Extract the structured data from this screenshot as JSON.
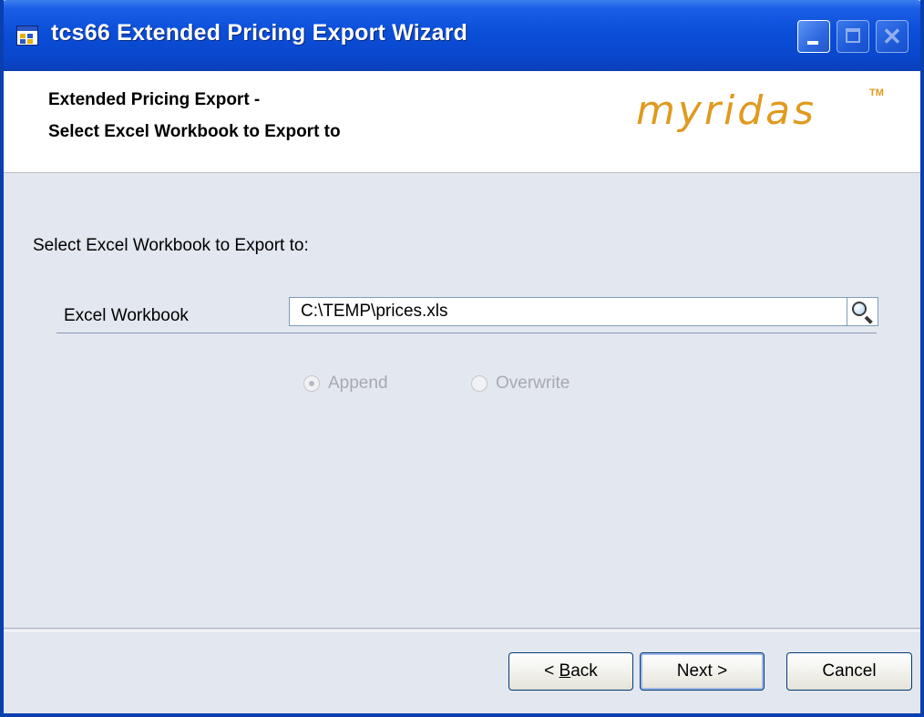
{
  "window": {
    "title": "tcs66 Extended Pricing Export Wizard",
    "controls": {
      "minimize_icon": "minimize-icon",
      "maximize_icon": "maximize-icon",
      "close_icon": "close-icon"
    },
    "titlebar_color": "#0a47cc"
  },
  "header": {
    "line1": "Extended Pricing Export -",
    "line2": "Select Excel Workbook to Export to",
    "logo": "myridas",
    "logo_tm": "TM",
    "logo_color": "#e09a1e"
  },
  "body": {
    "prompt": "Select Excel Workbook to Export to:",
    "field_label": "Excel Workbook",
    "workbook_path": "C:\\TEMP\\prices.xls",
    "browse_icon": "magnifier-icon",
    "options": {
      "append": {
        "label": "Append",
        "selected": true,
        "enabled": false
      },
      "overwrite": {
        "label": "Overwrite",
        "selected": false,
        "enabled": false
      }
    }
  },
  "footer": {
    "back_prefix": "< ",
    "back_mnemonic": "B",
    "back_rest": "ack",
    "next_label": "Next >",
    "cancel_label": "Cancel"
  }
}
